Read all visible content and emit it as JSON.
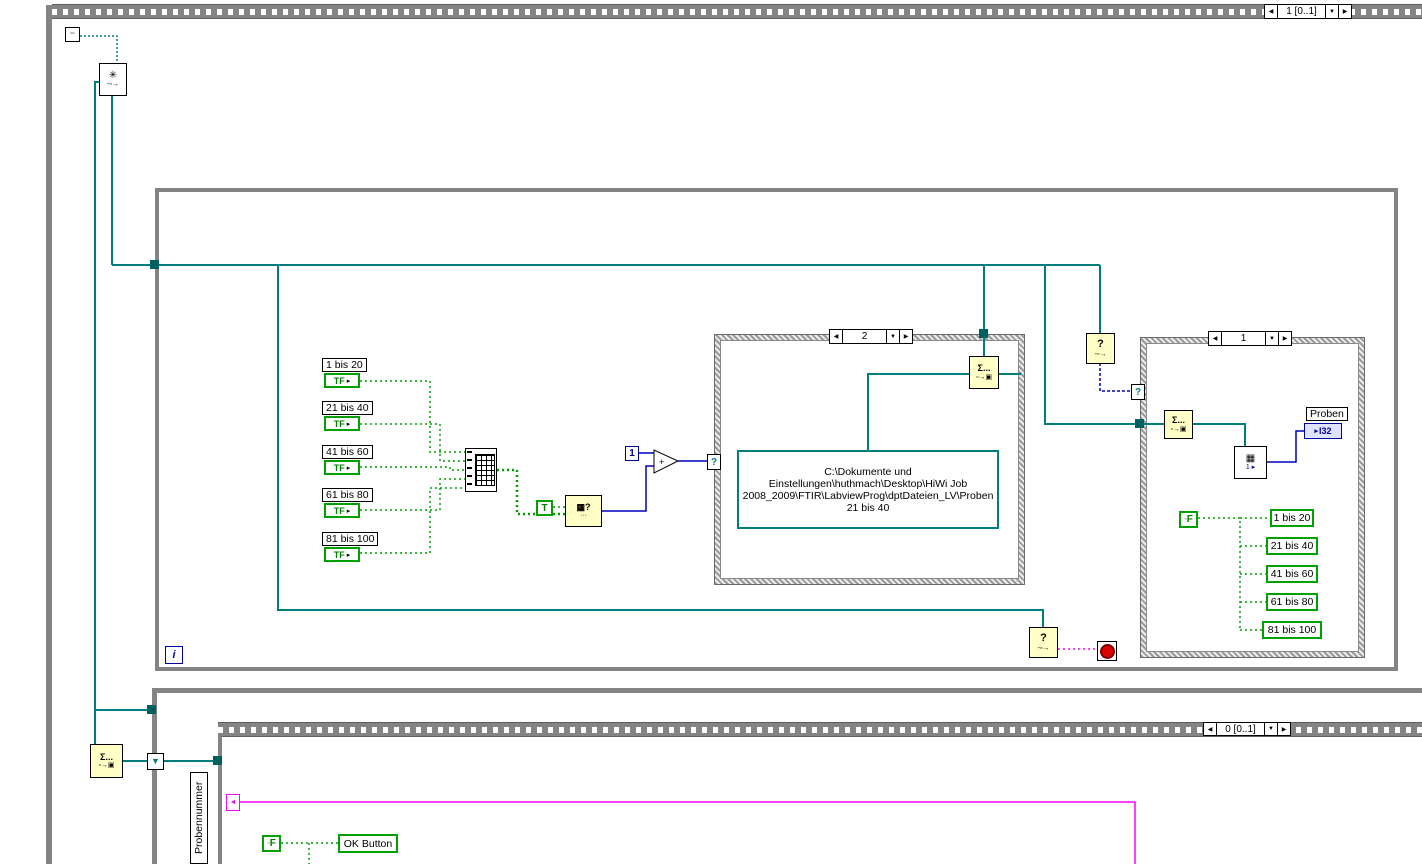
{
  "colors": {
    "structure_gray": "#848484",
    "wire_teal": "#007e7e",
    "wire_blue": "#0000d0",
    "wire_green": "#00a000",
    "wire_magenta": "#ff00ff",
    "node_yellow": "#ffffc6",
    "bool_green": "#00a000",
    "stop_red": "#dd0000"
  },
  "top_sequence": {
    "selector": "1 [0..1]"
  },
  "bottom_sequence": {
    "selector": "0 [0..1]"
  },
  "while_loop": {
    "iteration": "i"
  },
  "case_files": {
    "selector": "2",
    "path_constant": "C:\\Dokumente und Einstellungen\\huthmach\\Desktop\\HiWi Job 2008_2009\\FTIR\\LabviewProg\\dptDateien_LV\\Proben 21 bis 40"
  },
  "case_display": {
    "selector": "1"
  },
  "bool_controls": [
    {
      "label": "1 bis 20"
    },
    {
      "label": "21 bis 40"
    },
    {
      "label": "41 bis 60"
    },
    {
      "label": "61 bis 80"
    },
    {
      "label": "81 bis 100"
    }
  ],
  "bool_indicators": [
    {
      "label": "1 bis 20"
    },
    {
      "label": "21 bis 40"
    },
    {
      "label": "41 bis 60"
    },
    {
      "label": "61 bis 80"
    },
    {
      "label": "81 bis 100"
    }
  ],
  "labels": {
    "tf": "TF",
    "true_const": "T",
    "false_const": "F",
    "one_const": "1",
    "iteration": "i",
    "ok_button": "OK Button",
    "probennummer": "Probennummer",
    "proben": "Proben",
    "i32": "I32",
    "selector_question": "?"
  },
  "icons": {
    "arrow_left": "◀",
    "arrow_right": "▶",
    "arrow_down": "▼",
    "tri_right": "▸",
    "sigma": "Σ...",
    "box_arrow": "▫→▣",
    "question": "?",
    "dash_box_arrow": "-▫→",
    "asterisk": "✳",
    "grid": "▦",
    "dots": "···",
    "one_tri": "1 ▸",
    "plus": "+",
    "small_box": "▫",
    "feedback_arrow": "◄",
    "down_tri": "▼",
    "double_box": "▫▫"
  }
}
